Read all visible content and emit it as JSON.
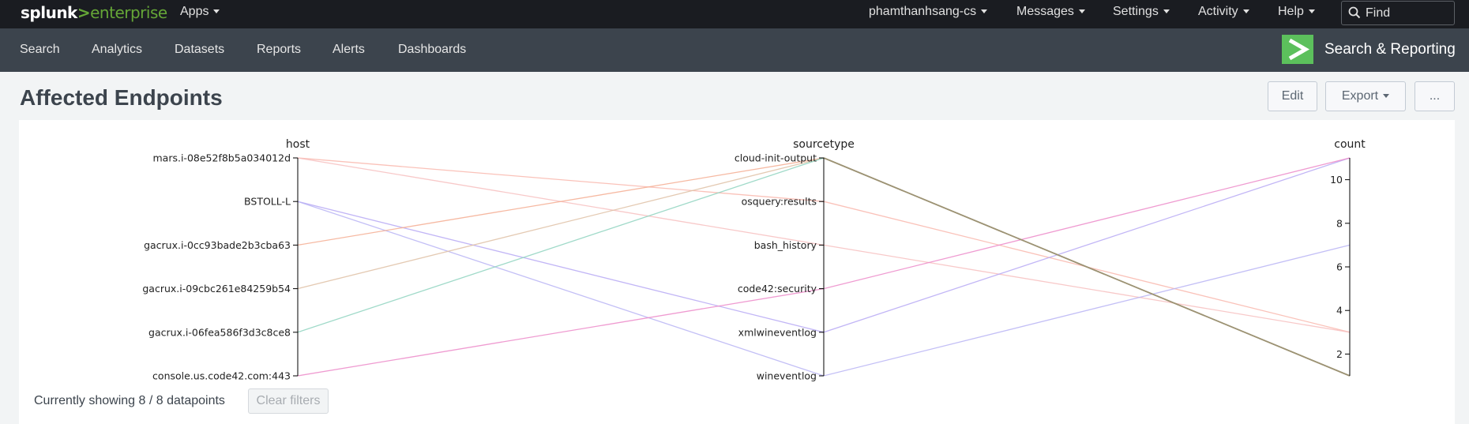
{
  "brand": {
    "splunk": "splunk",
    "gt": ">",
    "product": "enterprise"
  },
  "topbar": {
    "apps": "Apps",
    "user": "phamthanhsang-cs",
    "messages": "Messages",
    "settings": "Settings",
    "activity": "Activity",
    "help": "Help",
    "find_placeholder": "Find"
  },
  "nav": {
    "items": [
      "Search",
      "Analytics",
      "Datasets",
      "Reports",
      "Alerts",
      "Dashboards"
    ],
    "app_title": "Search & Reporting"
  },
  "dashboard": {
    "title": "Affected Endpoints",
    "edit": "Edit",
    "export": "Export",
    "more": "..."
  },
  "footer": {
    "status": "Currently showing 8 / 8 datapoints",
    "clear": "Clear filters"
  },
  "chart_data": {
    "type": "parallel-coordinates",
    "dimensions": [
      "host",
      "sourcetype",
      "count"
    ],
    "host_categories": [
      "mars.i-08e52f8b5a034012d",
      "BSTOLL-L",
      "gacrux.i-0cc93bade2b3cba63",
      "gacrux.i-09cbc261e84259b54",
      "gacrux.i-06fea586f3d3c8ce8",
      "console.us.code42.com:443"
    ],
    "sourcetype_categories": [
      "cloud-init-output",
      "osquery:results",
      "bash_history",
      "code42:security",
      "xmlwineventlog",
      "wineventlog"
    ],
    "count_ticks": [
      2,
      4,
      6,
      8,
      10
    ],
    "count_range": [
      1,
      11
    ],
    "records": [
      {
        "host": "mars.i-08e52f8b5a034012d",
        "sourcetype": "osquery:results",
        "count": 3,
        "color": "#f9b7ad"
      },
      {
        "host": "mars.i-08e52f8b5a034012d",
        "sourcetype": "bash_history",
        "count": 3,
        "color": "#f7bfbf"
      },
      {
        "host": "BSTOLL-L",
        "sourcetype": "xmlwineventlog",
        "count": 11,
        "color": "#b7a9f5"
      },
      {
        "host": "BSTOLL-L",
        "sourcetype": "wineventlog",
        "count": 7,
        "color": "#b9b4f4"
      },
      {
        "host": "gacrux.i-0cc93bade2b3cba63",
        "sourcetype": "cloud-init-output",
        "count": 1,
        "color": "#f5ad92"
      },
      {
        "host": "gacrux.i-09cbc261e84259b54",
        "sourcetype": "cloud-init-output",
        "count": 1,
        "color": "#dfc1a6"
      },
      {
        "host": "gacrux.i-06fea586f3d3c8ce8",
        "sourcetype": "cloud-init-output",
        "count": 1,
        "color": "#8fd3c0"
      },
      {
        "host": "console.us.code42.com:443",
        "sourcetype": "code42:security",
        "count": 11,
        "color": "#ec8ac9"
      }
    ],
    "brushed_color": "#9c9273"
  }
}
